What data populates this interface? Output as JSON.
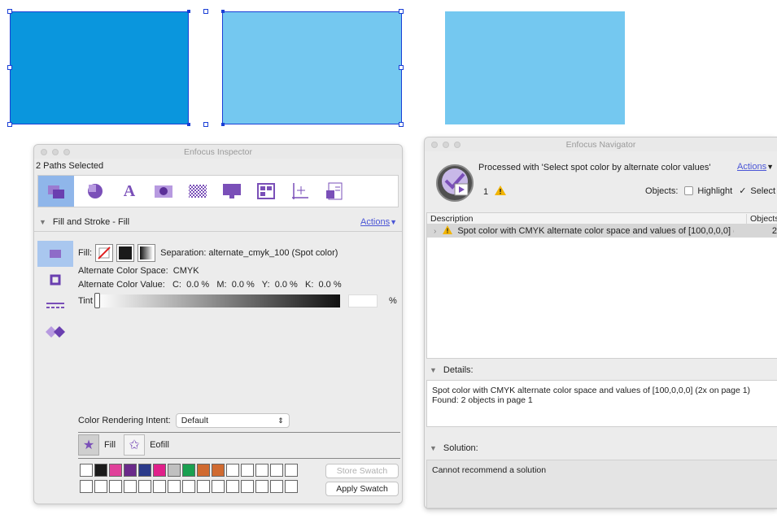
{
  "colors": {
    "shape_dark_blue": "#0a96dd",
    "shape_light_blue": "#74c8f0",
    "accent_purple": "#7a4fb8",
    "selection_blue": "#1a3fd6"
  },
  "inspector": {
    "title": "Enfocus Inspector",
    "selection_status": "2 Paths Selected",
    "section_title": "Fill and Stroke - Fill",
    "actions_label": "Actions",
    "fill_label": "Fill:",
    "separation_text": "Separation: alternate_cmyk_100 (Spot color)",
    "alt_color_space": "Alternate Color Space:  CMYK",
    "alt_color_value": "Alternate Color Value:   C:  0.0 %   M:  0.0 %   Y:  0.0 %   K:  0.0 %",
    "tint_label": "Tint",
    "tint_value": "",
    "percent_label": "%",
    "rendering_intent_label": "Color Rendering Intent:",
    "rendering_intent_value": "Default",
    "fill_button": "Fill",
    "eofill_button": "Eofill",
    "store_swatch": "Store Swatch",
    "apply_swatch": "Apply Swatch",
    "swatch_row1": [
      "#ffffff",
      "#1a1a1a",
      "#e0409a",
      "#6a2a8a",
      "#2a3a8a",
      "#e0208a",
      "#c0c0c0",
      "#1aa050",
      "#d06a30",
      "#d06a30",
      "#ffffff",
      "#ffffff",
      "#ffffff",
      "#ffffff",
      "#ffffff"
    ],
    "swatch_row2": [
      "#ffffff",
      "#ffffff",
      "#ffffff",
      "#ffffff",
      "#ffffff",
      "#ffffff",
      "#ffffff",
      "#ffffff",
      "#ffffff",
      "#ffffff",
      "#ffffff",
      "#ffffff",
      "#ffffff",
      "#ffffff",
      "#ffffff"
    ]
  },
  "navigator": {
    "title": "Enfocus Navigator",
    "processed_text": "Processed with 'Select spot color by alternate color values'",
    "actions_label": "Actions",
    "warning_count": "1",
    "objects_label": "Objects:",
    "highlight_label": "Highlight",
    "select_label": "Select",
    "col_description": "Description",
    "col_objects": "Objects",
    "result_row": "Spot color with CMYK alternate color space and values of [100,0,0,0] (...",
    "result_count": "2",
    "details_label": "Details:",
    "details_line1": "Spot color with CMYK alternate color space and values of [100,0,0,0] (2x on page 1)",
    "details_line2": "Found: 2 objects in page 1",
    "solution_label": "Solution:",
    "solution_text": "Cannot recommend a solution"
  }
}
